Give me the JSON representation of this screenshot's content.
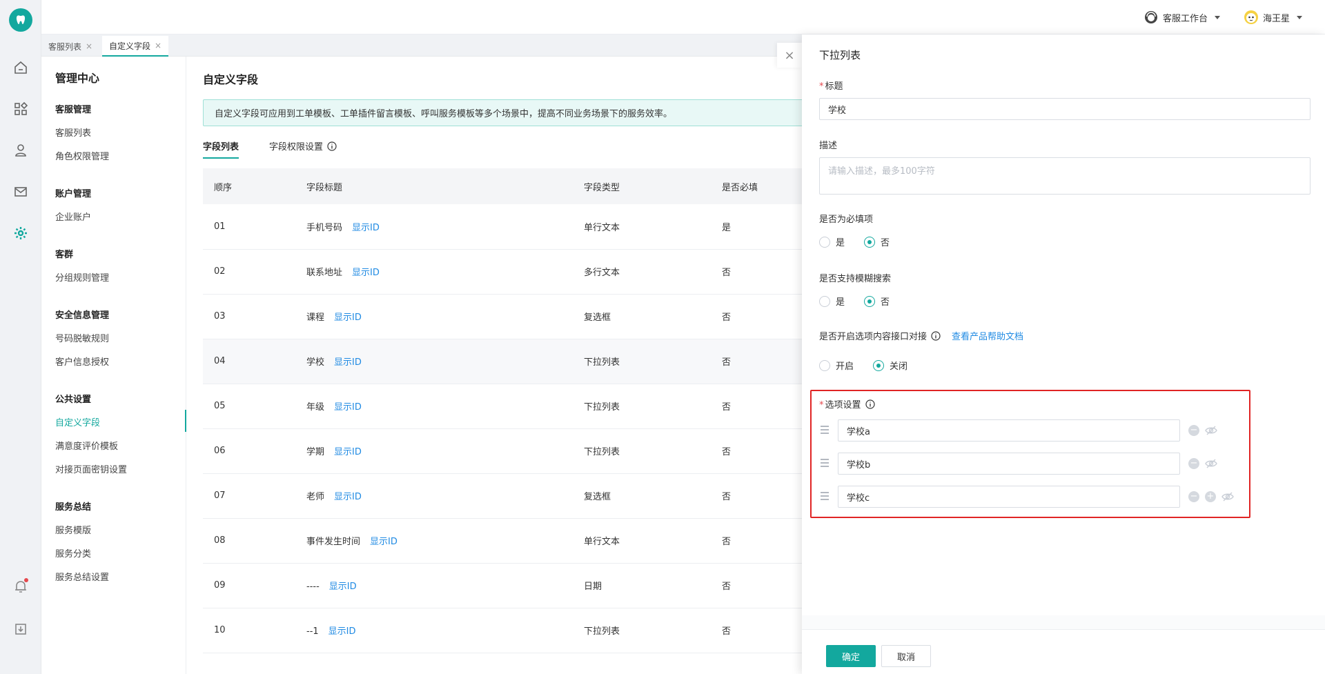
{
  "topbar": {
    "workspace_label": "客服工作台",
    "user_name": "海王星"
  },
  "tabs": [
    {
      "label": "客服列表",
      "close": "×"
    },
    {
      "label": "自定义字段",
      "close": "×"
    }
  ],
  "menu": {
    "title": "管理中心",
    "groups": [
      {
        "title": "客服管理",
        "items": [
          "客服列表",
          "角色权限管理"
        ]
      },
      {
        "title": "账户管理",
        "items": [
          "企业账户"
        ]
      },
      {
        "title": "客群",
        "items": [
          "分组规则管理"
        ]
      },
      {
        "title": "安全信息管理",
        "items": [
          "号码脱敏规则",
          "客户信息授权"
        ]
      },
      {
        "title": "公共设置",
        "items": [
          "自定义字段",
          "满意度评价模板",
          "对接页面密钥设置"
        ]
      },
      {
        "title": "服务总结",
        "items": [
          "服务模版",
          "服务分类",
          "服务总结设置"
        ]
      }
    ],
    "active_item": "自定义字段"
  },
  "main": {
    "title": "自定义字段",
    "info": "自定义字段可应用到工单模板、工单插件留言模板、呼叫服务模板等多个场景中，提高不同业务场景下的服务效率。",
    "subtabs": [
      "字段列表",
      "字段权限设置"
    ],
    "table": {
      "columns": [
        "顺序",
        "字段标题",
        "字段类型",
        "是否必填"
      ],
      "link_label": "显示ID",
      "rows": [
        {
          "order": "01",
          "title": "手机号码",
          "type": "单行文本",
          "required": "是"
        },
        {
          "order": "02",
          "title": "联系地址",
          "type": "多行文本",
          "required": "否"
        },
        {
          "order": "03",
          "title": "课程",
          "type": "复选框",
          "required": "否"
        },
        {
          "order": "04",
          "title": "学校",
          "type": "下拉列表",
          "required": "否"
        },
        {
          "order": "05",
          "title": "年级",
          "type": "下拉列表",
          "required": "否"
        },
        {
          "order": "06",
          "title": "学期",
          "type": "下拉列表",
          "required": "否"
        },
        {
          "order": "07",
          "title": "老师",
          "type": "复选框",
          "required": "否"
        },
        {
          "order": "08",
          "title": "事件发生时间",
          "type": "单行文本",
          "required": "否"
        },
        {
          "order": "09",
          "title": "----",
          "type": "日期",
          "required": "否"
        },
        {
          "order": "10",
          "title": "--1",
          "type": "下拉列表",
          "required": "否"
        }
      ]
    }
  },
  "drawer": {
    "close": "×",
    "title": "下拉列表",
    "title_label": "标题",
    "title_value": "学校",
    "desc_label": "描述",
    "desc_placeholder": "请输入描述，最多100字符",
    "required_label": "是否为必填项",
    "required_options": [
      "是",
      "否"
    ],
    "required_selected": "否",
    "fuzzy_label": "是否支持模糊搜索",
    "fuzzy_options": [
      "是",
      "否"
    ],
    "fuzzy_selected": "否",
    "api_label": "是否开启选项内容接口对接",
    "api_help_link": "查看产品帮助文档",
    "api_options": [
      "开启",
      "关闭"
    ],
    "api_selected": "关闭",
    "options_label": "选项设置",
    "options": [
      "学校a",
      "学校b",
      "学校c"
    ],
    "ok": "确定",
    "cancel": "取消"
  },
  "colors": {
    "accent": "#13a89e",
    "link": "#1f8ae3",
    "highlight_border": "#e02424"
  }
}
